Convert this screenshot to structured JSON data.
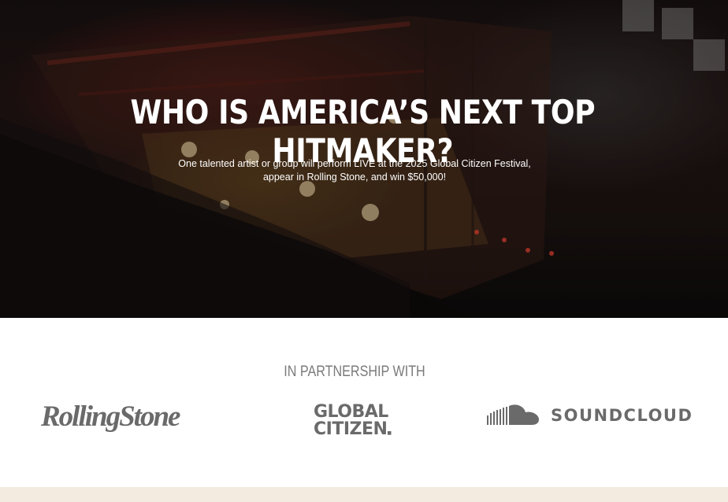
{
  "hero": {
    "title": "WHO IS AMERICA’S NEXT TOP HITMAKER?",
    "subtitle_line1": "One talented artist or group will perform LIVE at the 2025 Global Citizen Festival,",
    "subtitle_line2": "appear in Rolling Stone, and win $50,000!"
  },
  "partners": {
    "heading": "IN PARTNERSHIP WITH",
    "logos": [
      {
        "name": "RollingStone",
        "icon": "rolling-stone-logo"
      },
      {
        "name_line1": "GLOBAL",
        "name_line2": "CITIZEN",
        "icon": "global-citizen-logo"
      },
      {
        "name": "SOUNDCLOUD",
        "icon": "soundcloud-logo"
      }
    ]
  },
  "colors": {
    "logo_gray": "#6a6a6a",
    "heading_gray": "#7a7a7a",
    "bottom_band": "#f3ebe0"
  }
}
